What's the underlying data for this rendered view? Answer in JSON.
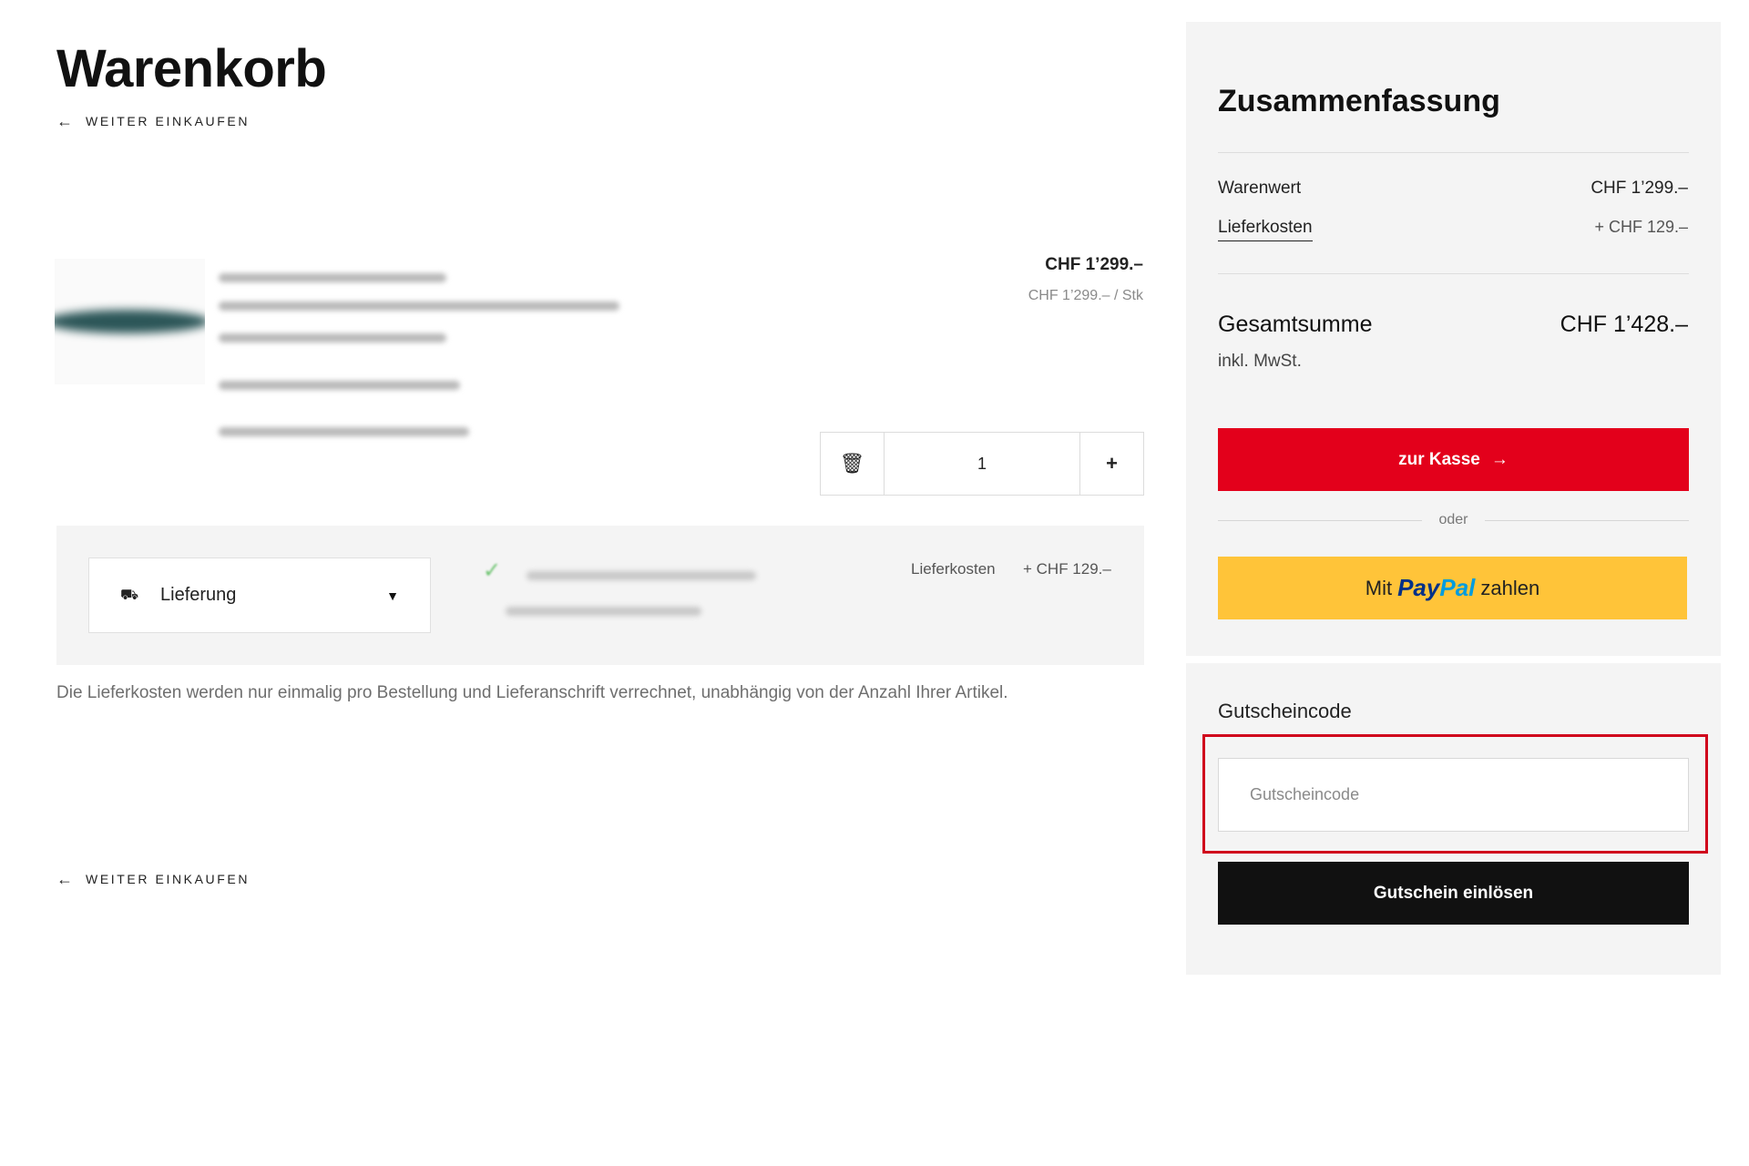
{
  "page": {
    "title": "Warenkorb"
  },
  "nav": {
    "back_label": "WEITER EINKAUFEN",
    "back_arrow": "←"
  },
  "item": {
    "price": "CHF 1’299.–",
    "unit_price": "CHF 1’299.– / Stk",
    "quantity": "1",
    "trash_icon": "🗑",
    "plus_label": "+"
  },
  "delivery": {
    "option": "Lieferung",
    "truck_icon": "⛟",
    "caret": "▼",
    "check_icon": "✓",
    "cost_label": "Lieferkosten",
    "cost_value": "+ CHF 129.–",
    "note": "Die Lieferkosten werden nur einmalig pro Bestellung und Lieferanschrift verrechnet, unabhängig von der Anzahl Ihrer Artikel."
  },
  "summary": {
    "title": "Zusammenfassung",
    "goods_label": "Warenwert",
    "goods_value": "CHF 1’299.–",
    "shipping_label": "Lieferkosten",
    "shipping_value": "+ CHF 129.–",
    "total_label": "Gesamtsumme",
    "total_value": "CHF 1’428.–",
    "vat_note": "inkl. MwSt.",
    "checkout_label": "zur Kasse",
    "checkout_arrow": "→",
    "or_label": "oder",
    "paypal_prefix": "Mit",
    "paypal_pay": "Pay",
    "paypal_pal": "Pal",
    "paypal_suffix": "zahlen"
  },
  "coupon": {
    "title": "Gutscheincode",
    "placeholder": "Gutscheincode",
    "button_label": "Gutschein einlösen"
  },
  "colors": {
    "accent_red": "#e3001b",
    "paypal_yellow": "#ffc439",
    "highlight": "#d0021b"
  }
}
